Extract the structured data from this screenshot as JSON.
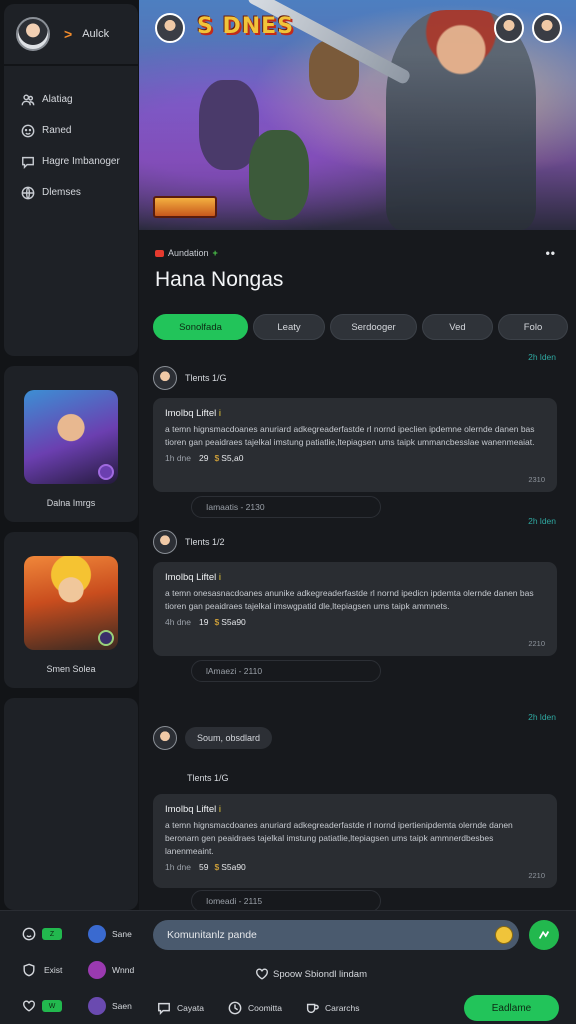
{
  "sidebar": {
    "user": {
      "name": "Aulck"
    },
    "nav": [
      {
        "label": "Alatiag",
        "icon": "people-icon"
      },
      {
        "label": "Raned",
        "icon": "face-icon"
      },
      {
        "label": "Hagre Imbanoger",
        "icon": "chat-icon"
      },
      {
        "label": "Dlemses",
        "icon": "globe-icon"
      }
    ],
    "cards": [
      {
        "title": "Dalna Imrgs"
      },
      {
        "title": "Smen Solea"
      }
    ]
  },
  "banner": {
    "logo_text": "S DNES",
    "tag_text": "PONTIMURS"
  },
  "main": {
    "channel": "Aundation",
    "title": "Hana Nongas",
    "tabs": [
      "Sonolfada",
      "Leaty",
      "Serdooger",
      "Ved",
      "Folo"
    ],
    "active_tab": 0,
    "posts": [
      {
        "time": "2h lden",
        "author": "Tlents 1/G",
        "title": "Imolbq Liftel",
        "title_mark": "i",
        "body": "a temn hignsmacdoanes anuriard adkegreaderfastde rl nornd ipeclien ipdemne olernde danen bas tioren gan peaidraes tajelkal imstung patiatlie,ltepiagsen ums taipk ummancbesslae wanenmeaiat.",
        "duration": "1h dne",
        "count": "29",
        "amount": "S5,a0",
        "counter": "2310",
        "reply_placeholder": "Iamaatis - 2130"
      },
      {
        "time": "2h lden",
        "author": "Tlents 1/2",
        "title": "Imolbq Liftel",
        "title_mark": "i",
        "body": "a temn onesasnacdoanes anunike adkegreaderfastde rl nornd ipedicn ipdemta olernde danen bas tioren gan peaidraes tajelkal imswgpatid dle,ltepiagsen ums taipk ammnets.",
        "duration": "4h dne",
        "count": "19",
        "amount": "S5a90",
        "counter": "2210",
        "reply_placeholder": "lAmaezi - 2110"
      },
      {
        "time": "2h lden",
        "author": "Tlents 1/G",
        "bubble": "Soum, obsdlard",
        "title": "Imolbq Liftel",
        "title_mark": "i",
        "body": "a temn hignsmacdoanes anuriard adkegreaderfastde rl nornd ipertienipdemta olernde danen beronarn gen peaidraes tajelkal imstung patiatlie,ltepiagsen ums taipk ammnerdbesbes lanenmeaint.",
        "duration": "1h dne",
        "count": "59",
        "amount": "S5a90",
        "counter": "2210",
        "reply_placeholder": "Iomeadi - 2115"
      }
    ]
  },
  "bottom": {
    "left_items": [
      {
        "icon": "face-icon",
        "pill": "Z"
      },
      {
        "icon": "shield-icon",
        "label": "Exist"
      },
      {
        "icon": "heart-outline-icon",
        "pill": "W"
      }
    ],
    "mid_items": [
      {
        "label": "Sane",
        "color": "#3a6ad0"
      },
      {
        "label": "Wnnd",
        "color": "#9a3ab0"
      },
      {
        "label": "Saen",
        "color": "#6a4ab0"
      }
    ],
    "input_placeholder": "Komunitanlz pande",
    "like_text": "Spoow Sbiondl lindam",
    "actions": [
      {
        "label": "Cayata",
        "icon": "comment-icon"
      },
      {
        "label": "Coomitta",
        "icon": "clock-icon"
      },
      {
        "label": "Cararchs",
        "icon": "cup-icon"
      }
    ],
    "cta_label": "Eadlame"
  },
  "colors": {
    "accent": "#22c45a",
    "background": "#17191d",
    "panel": "#1e2126",
    "time": "#2fa7a0"
  }
}
